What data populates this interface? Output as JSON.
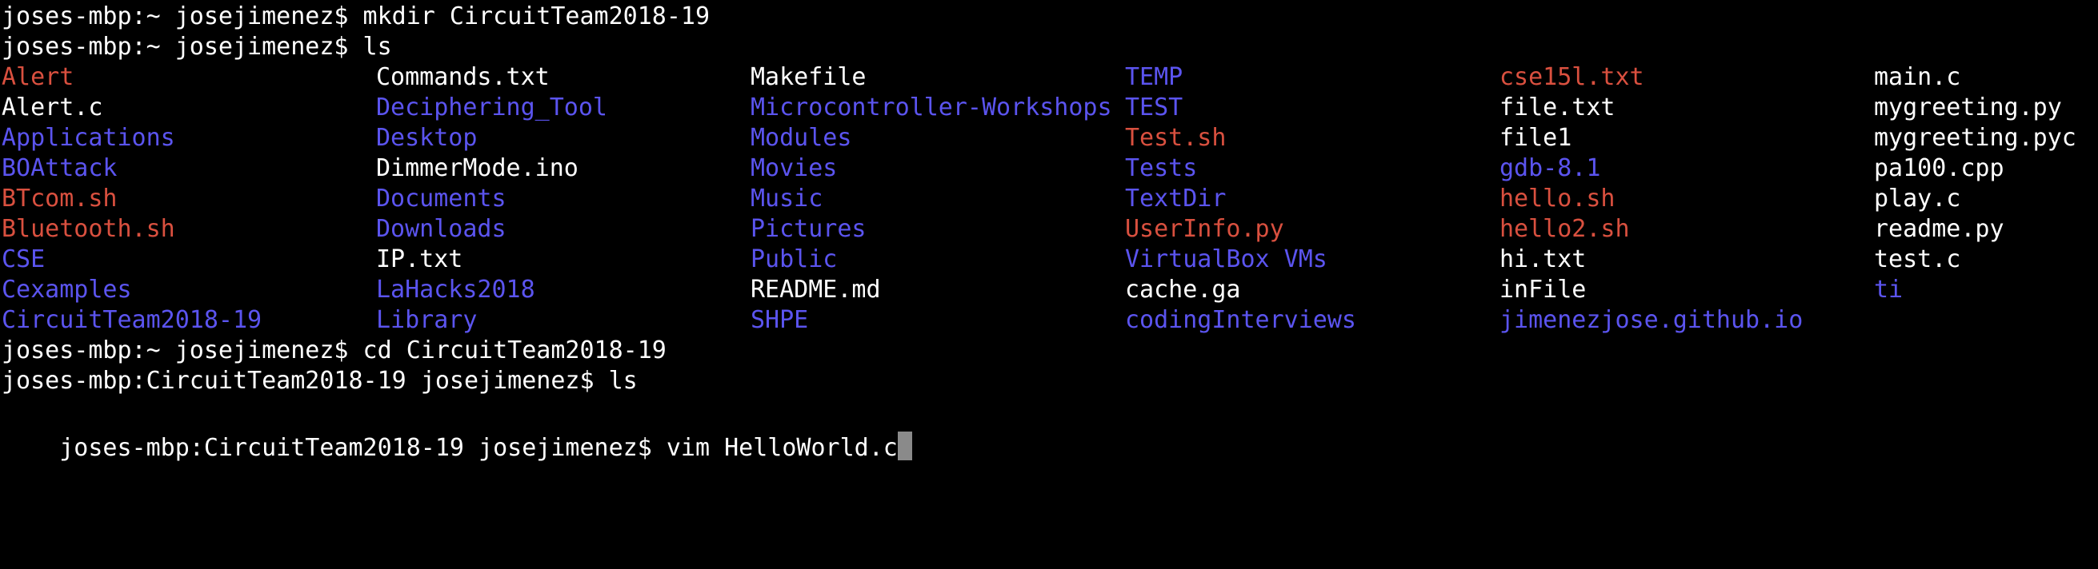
{
  "terminal": {
    "lines": [
      "joses-mbp:~ josejimenez$ mkdir CircuitTeam2018-19",
      "joses-mbp:~ josejimenez$ ls",
      "joses-mbp:~ josejimenez$ cd CircuitTeam2018-19",
      "joses-mbp:CircuitTeam2018-19 josejimenez$ ls",
      "joses-mbp:CircuitTeam2018-19 josejimenez$ vim HelloWorld.c"
    ],
    "listing": {
      "columns": [
        [
          {
            "name": "Alert",
            "color": "#d9503f"
          },
          {
            "name": "Alert.c",
            "color": "#ffffff"
          },
          {
            "name": "Applications",
            "color": "#5b54ef"
          },
          {
            "name": "BOAttack",
            "color": "#5b54ef"
          },
          {
            "name": "BTcom.sh",
            "color": "#d9503f"
          },
          {
            "name": "Bluetooth.sh",
            "color": "#d9503f"
          },
          {
            "name": "CSE",
            "color": "#5b54ef"
          },
          {
            "name": "Cexamples",
            "color": "#5b54ef"
          },
          {
            "name": "CircuitTeam2018-19",
            "color": "#5b54ef"
          }
        ],
        [
          {
            "name": "Commands.txt",
            "color": "#ffffff"
          },
          {
            "name": "Deciphering_Tool",
            "color": "#5b54ef"
          },
          {
            "name": "Desktop",
            "color": "#5b54ef"
          },
          {
            "name": "DimmerMode.ino",
            "color": "#ffffff"
          },
          {
            "name": "Documents",
            "color": "#5b54ef"
          },
          {
            "name": "Downloads",
            "color": "#5b54ef"
          },
          {
            "name": "IP.txt",
            "color": "#ffffff"
          },
          {
            "name": "LaHacks2018",
            "color": "#5b54ef"
          },
          {
            "name": "Library",
            "color": "#5b54ef"
          }
        ],
        [
          {
            "name": "Makefile",
            "color": "#ffffff"
          },
          {
            "name": "Microcontroller-Workshops",
            "color": "#5b54ef"
          },
          {
            "name": "Modules",
            "color": "#5b54ef"
          },
          {
            "name": "Movies",
            "color": "#5b54ef"
          },
          {
            "name": "Music",
            "color": "#5b54ef"
          },
          {
            "name": "Pictures",
            "color": "#5b54ef"
          },
          {
            "name": "Public",
            "color": "#5b54ef"
          },
          {
            "name": "README.md",
            "color": "#ffffff"
          },
          {
            "name": "SHPE",
            "color": "#5b54ef"
          }
        ],
        [
          {
            "name": "TEMP",
            "color": "#5b54ef"
          },
          {
            "name": "TEST",
            "color": "#5b54ef"
          },
          {
            "name": "Test.sh",
            "color": "#d9503f"
          },
          {
            "name": "Tests",
            "color": "#5b54ef"
          },
          {
            "name": "TextDir",
            "color": "#5b54ef"
          },
          {
            "name": "UserInfo.py",
            "color": "#d9503f"
          },
          {
            "name": "VirtualBox VMs",
            "color": "#5b54ef"
          },
          {
            "name": "cache.ga",
            "color": "#ffffff"
          },
          {
            "name": "codingInterviews",
            "color": "#5b54ef"
          }
        ],
        [
          {
            "name": "cse15l.txt",
            "color": "#d9503f"
          },
          {
            "name": "file.txt",
            "color": "#ffffff"
          },
          {
            "name": "file1",
            "color": "#ffffff"
          },
          {
            "name": "gdb-8.1",
            "color": "#5b54ef"
          },
          {
            "name": "hello.sh",
            "color": "#d9503f"
          },
          {
            "name": "hello2.sh",
            "color": "#d9503f"
          },
          {
            "name": "hi.txt",
            "color": "#ffffff"
          },
          {
            "name": "inFile",
            "color": "#ffffff"
          },
          {
            "name": "jimenezjose.github.io",
            "color": "#5b54ef"
          }
        ],
        [
          {
            "name": "main.c",
            "color": "#ffffff"
          },
          {
            "name": "mygreeting.py",
            "color": "#ffffff"
          },
          {
            "name": "mygreeting.pyc",
            "color": "#ffffff"
          },
          {
            "name": "pa100.cpp",
            "color": "#ffffff"
          },
          {
            "name": "play.c",
            "color": "#ffffff"
          },
          {
            "name": "readme.py",
            "color": "#ffffff"
          },
          {
            "name": "test.c",
            "color": "#ffffff"
          },
          {
            "name": "ti",
            "color": "#5b54ef"
          }
        ]
      ]
    },
    "colors": {
      "background": "#000000",
      "text": "#ffffff",
      "directory": "#5b54ef",
      "executable": "#d9503f",
      "cursor": "#8a8a8a"
    }
  }
}
